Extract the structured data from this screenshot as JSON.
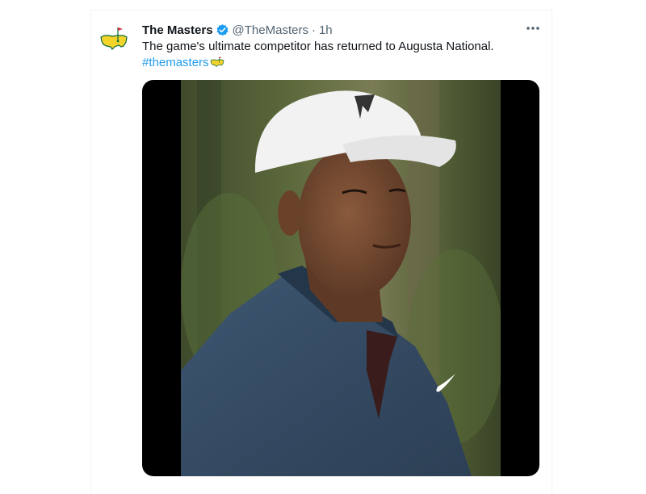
{
  "tweet": {
    "display_name": "The Masters",
    "handle": "@TheMasters",
    "separator": "·",
    "time": "1h",
    "text": "The game's ultimate competitor has returned to Augusta National.",
    "hashtag": "#themasters",
    "more_label": "•••"
  },
  "icons": {
    "avatar": "masters-logo-icon",
    "verified": "verified-badge-icon",
    "hashtag_emoji": "masters-logo-icon",
    "more": "more-options-icon"
  },
  "colors": {
    "link": "#1d9bf0",
    "secondary_text": "#536471",
    "logo_yellow": "#f4d32a",
    "logo_green": "#0a6b3a"
  }
}
